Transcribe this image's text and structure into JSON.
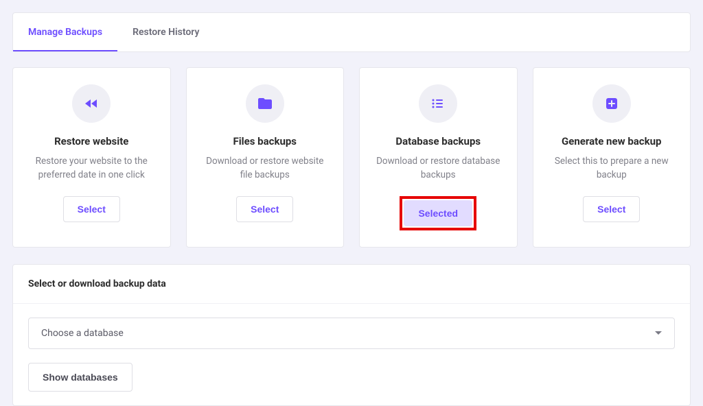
{
  "tabs": [
    {
      "label": "Manage Backups",
      "active": true
    },
    {
      "label": "Restore History",
      "active": false
    }
  ],
  "cards": [
    {
      "icon": "rewind",
      "title": "Restore website",
      "desc": "Restore your website to the preferred date in one click",
      "button": "Select",
      "selected": false
    },
    {
      "icon": "folder",
      "title": "Files backups",
      "desc": "Download or restore website file backups",
      "button": "Select",
      "selected": false
    },
    {
      "icon": "list",
      "title": "Database backups",
      "desc": "Download or restore database backups",
      "button": "Selected",
      "selected": true,
      "highlighted": true
    },
    {
      "icon": "add",
      "title": "Generate new backup",
      "desc": "Select this to prepare a new backup",
      "button": "Select",
      "selected": false
    }
  ],
  "section": {
    "title": "Select or download backup data",
    "dropdown_placeholder": "Choose a database",
    "show_button": "Show databases"
  }
}
